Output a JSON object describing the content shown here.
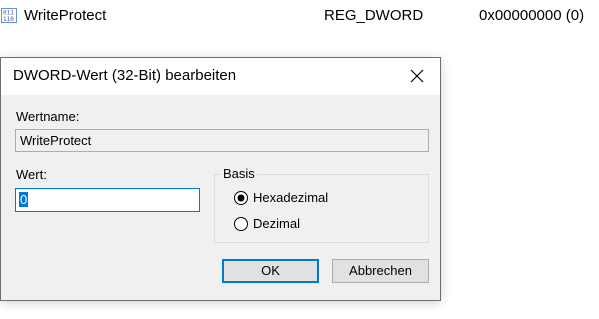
{
  "registry_row": {
    "icon": "registry-binary-value-icon",
    "name": "WriteProtect",
    "type": "REG_DWORD",
    "data": "0x00000000 (0)"
  },
  "dialog": {
    "title": "DWORD-Wert (32-Bit) bearbeiten",
    "close_icon": "close-icon",
    "name_label": "Wertname:",
    "name_value": "WriteProtect",
    "value_label": "Wert:",
    "value_value": "0",
    "basis": {
      "legend": "Basis",
      "options": [
        {
          "label": "Hexadezimal",
          "selected": true
        },
        {
          "label": "Dezimal",
          "selected": false
        }
      ]
    },
    "ok_label": "OK",
    "cancel_label": "Abbrechen"
  },
  "colors": {
    "accent": "#0078d7",
    "dialog_background": "#f0f0f0",
    "button_face": "#e1e1e1"
  }
}
